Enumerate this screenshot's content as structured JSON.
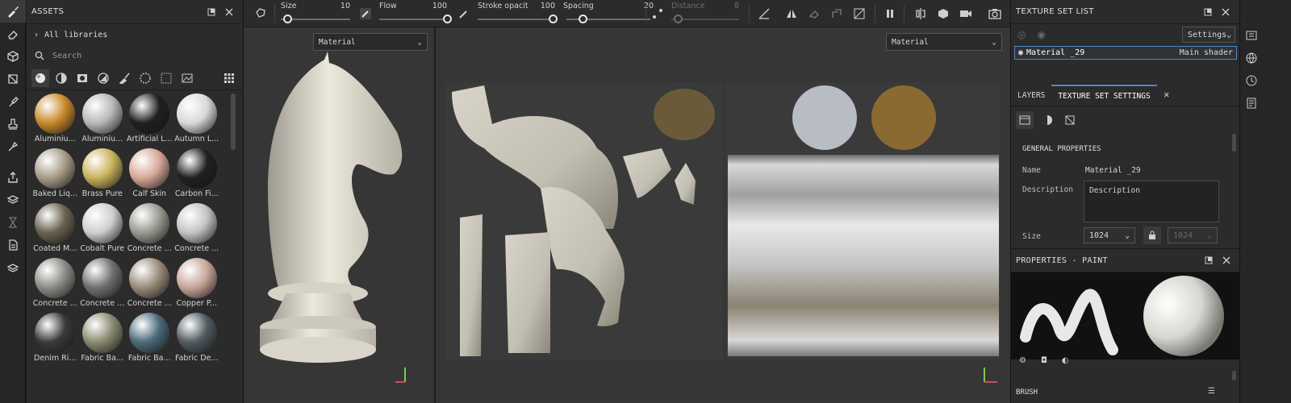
{
  "assets": {
    "title": "ASSETS",
    "libraries_label": "All libraries",
    "search_placeholder": "Search",
    "filters": [
      "materials-filter-icon",
      "smart-materials-filter-icon",
      "masks-filter-icon",
      "smart-masks-filter-icon",
      "brushes-filter-icon",
      "textures-filter-icon",
      "alphas-filter-icon",
      "environments-filter-icon"
    ],
    "items": [
      {
        "name": "Aluminiu...",
        "color": "#c88a2a"
      },
      {
        "name": "Aluminiu...",
        "color": "#b8b8b8"
      },
      {
        "name": "Artificial L...",
        "color": "#1f1f1f"
      },
      {
        "name": "Autumn L...",
        "color": "#d9d9d9"
      },
      {
        "name": "Baked Liq...",
        "color": "#a89c88"
      },
      {
        "name": "Brass Pure",
        "color": "#c9b25a"
      },
      {
        "name": "Calf Skin",
        "color": "#d8a898"
      },
      {
        "name": "Carbon Fi...",
        "color": "#202020"
      },
      {
        "name": "Coated M...",
        "color": "#6a6250"
      },
      {
        "name": "Cobalt Pure",
        "color": "#cfcfcf"
      },
      {
        "name": "Concrete ...",
        "color": "#9a9a92"
      },
      {
        "name": "Concrete ...",
        "color": "#c4c4c4"
      },
      {
        "name": "Concrete ...",
        "color": "#8c8c88"
      },
      {
        "name": "Concrete ...",
        "color": "#707070"
      },
      {
        "name": "Concrete ...",
        "color": "#9a8c7c"
      },
      {
        "name": "Copper P...",
        "color": "#c9a79a"
      },
      {
        "name": "Denim Ri...",
        "color": "#3a3a3a"
      },
      {
        "name": "Fabric Ba...",
        "color": "#8a8a72"
      },
      {
        "name": "Fabric Ba...",
        "color": "#4a6a7a"
      },
      {
        "name": "Fabric De...",
        "color": "#505a60"
      }
    ]
  },
  "toolbar": {
    "size_label": "Size",
    "size_value": "10",
    "size_fraction": 0.1,
    "flow_label": "Flow",
    "flow_value": "100",
    "flow_fraction": 1.0,
    "stroke_label": "Stroke opacit",
    "stroke_value": "100",
    "stroke_fraction": 1.0,
    "spacing_label": "Spacing",
    "spacing_value": "20",
    "spacing_fraction": 0.2,
    "distance_label": "Distance",
    "distance_value": "8",
    "distance_fraction": 0.1
  },
  "viewport3d": {
    "channel_select": "Material"
  },
  "viewport2d": {
    "channel_select": "Material"
  },
  "texture_set_list": {
    "title": "TEXTURE SET LIST",
    "settings_label": "Settings",
    "item_name": "Material _29",
    "item_shader": "Main shader"
  },
  "tabs": {
    "layers": "LAYERS",
    "texture_set_settings": "TEXTURE SET SETTINGS"
  },
  "general": {
    "section_title": "GENERAL PROPERTIES",
    "name_label": "Name",
    "name_value": "Material _29",
    "description_label": "Description",
    "description_value": "Description",
    "size_label": "Size",
    "size_value": "1024",
    "size_linked_value": "1024"
  },
  "properties": {
    "title": "PROPERTIES - PAINT",
    "brush_label": "BRUSH"
  },
  "colors": {
    "accent": "#4f88c6",
    "panel": "#2b2b2b",
    "viewport": "#363636",
    "model": "#e8e4d8"
  }
}
